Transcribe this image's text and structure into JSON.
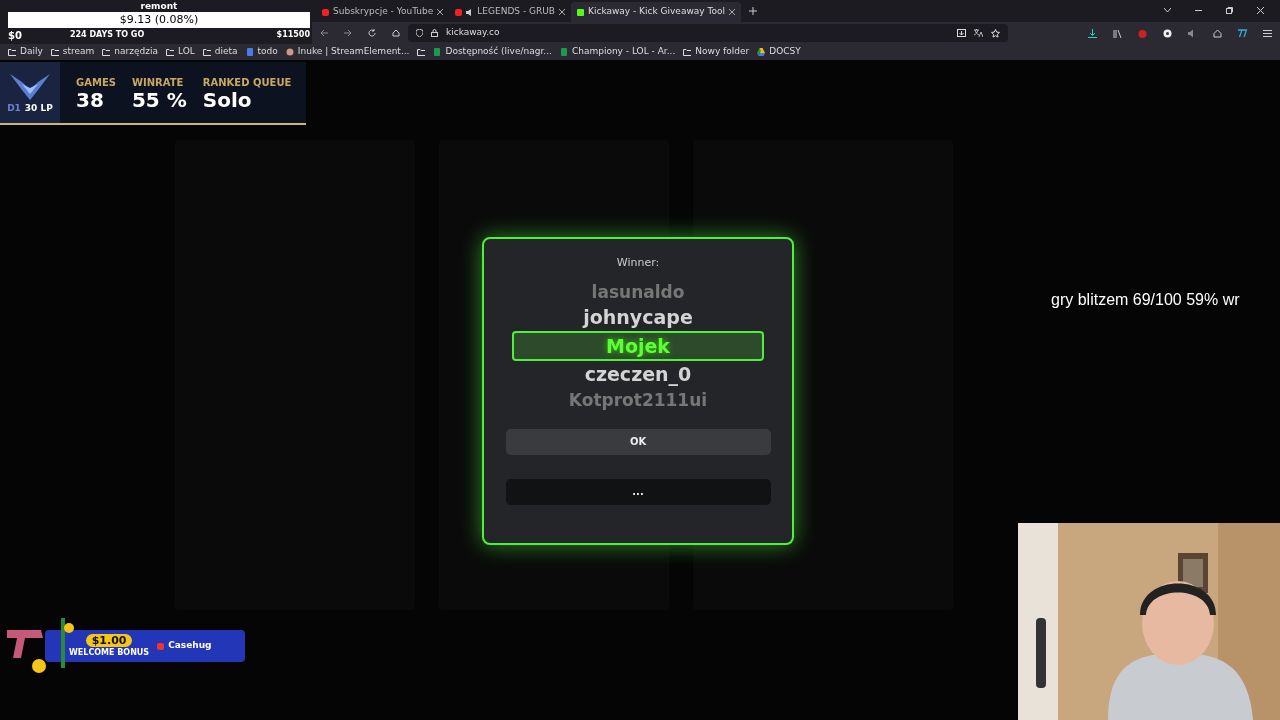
{
  "browser": {
    "tabs": [
      {
        "title": "Subskrypcje - YouTube",
        "selected": false,
        "muted": false
      },
      {
        "title": "LEGENDS - GRUB",
        "selected": false,
        "muted": true
      },
      {
        "title": "Kickaway - Kick Giveaway Tool",
        "selected": true,
        "muted": false
      }
    ],
    "url": "kickaway.co",
    "bookmarks": [
      {
        "label": "Daily",
        "kind": "folder"
      },
      {
        "label": "stream",
        "kind": "folder"
      },
      {
        "label": "narzędzia",
        "kind": "folder"
      },
      {
        "label": "LOL",
        "kind": "folder"
      },
      {
        "label": "dieta",
        "kind": "folder"
      },
      {
        "label": "todo",
        "kind": "doc"
      },
      {
        "label": "Inuke | StreamElement...",
        "kind": "avatar"
      },
      {
        "kind": "folder"
      },
      {
        "label": "Dostępność (live/nagr...",
        "kind": "sheet"
      },
      {
        "label": "Championy - LOL - Ar...",
        "kind": "sheet"
      },
      {
        "label": "Nowy folder",
        "kind": "folder"
      },
      {
        "label": "DOCSY",
        "kind": "drive"
      }
    ]
  },
  "overlays": {
    "donation": "$9.13 (0.08%)",
    "title": "remont",
    "goal": {
      "current": "$0",
      "days": "224 DAYS TO GO",
      "target": "$11500"
    },
    "rank": {
      "tier": "D1",
      "lp": "30 LP",
      "stats": [
        {
          "label": "GAMES",
          "value": "38"
        },
        {
          "label": "WINRATE",
          "value": "55 %"
        },
        {
          "label": "RANKED QUEUE",
          "value": "Solo"
        }
      ]
    },
    "note": "gry blitzem 69/100 59% wr",
    "promo": {
      "amount": "$1.00",
      "caption": "WELCOME BONUS",
      "brand": "Casehug"
    }
  },
  "modal": {
    "label": "Winner:",
    "names": [
      {
        "name": "lasunaldo",
        "selected": false,
        "faded": true
      },
      {
        "name": "johnycape",
        "selected": false,
        "faded": false
      },
      {
        "name": "Mojek",
        "selected": true,
        "faded": false
      },
      {
        "name": "czeczen_0",
        "selected": false,
        "faded": false
      },
      {
        "name": "Kotprot2111ui",
        "selected": false,
        "faded": true
      }
    ],
    "buttons": [
      {
        "label": "OK",
        "kind": "secondary"
      },
      {
        "label": "...",
        "kind": "dark"
      }
    ]
  }
}
